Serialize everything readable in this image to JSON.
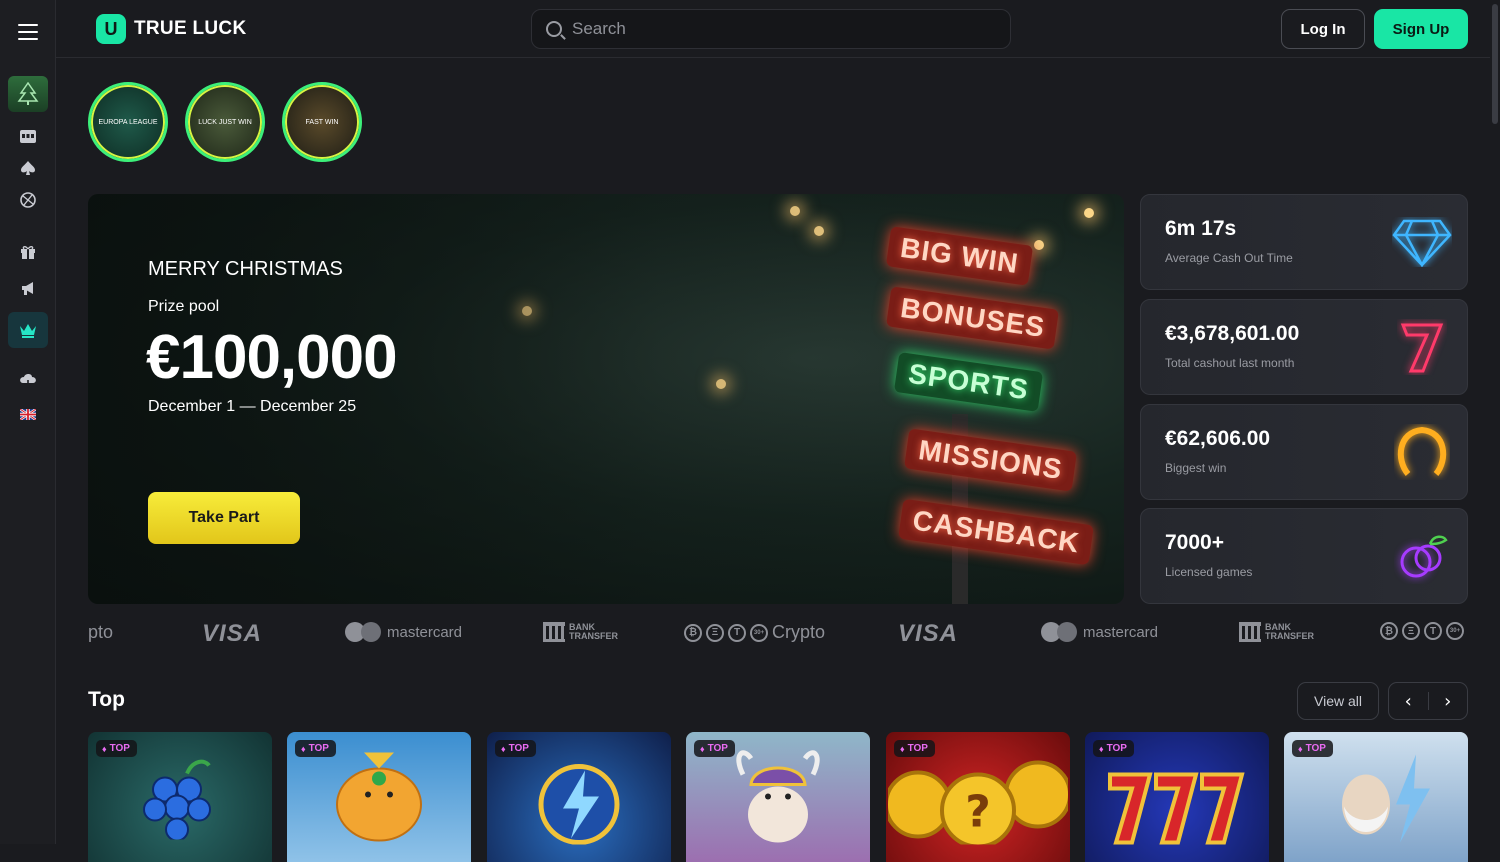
{
  "header": {
    "brand": "TRUE LUCK",
    "brand_mark": "U",
    "search_placeholder": "Search",
    "login_label": "Log In",
    "signup_label": "Sign Up"
  },
  "sidebar": {
    "items": [
      {
        "icon": "tree-icon"
      },
      {
        "icon": "slot-machine-icon"
      },
      {
        "icon": "spade-icon"
      },
      {
        "icon": "sports-ball-icon"
      },
      {
        "icon": "gift-icon"
      },
      {
        "icon": "megaphone-icon"
      },
      {
        "icon": "crown-icon"
      },
      {
        "icon": "cloud-download-icon"
      },
      {
        "icon": "uk-flag-icon"
      }
    ]
  },
  "stories": [
    {
      "caption": "EUROPA LEAGUE"
    },
    {
      "caption": "LUCK JUST WIN"
    },
    {
      "caption": "FAST WIN"
    }
  ],
  "banner": {
    "title": "MERRY CHRISTMAS",
    "subtitle": "Prize pool",
    "amount": "€100,000",
    "dates": "December 1 — December 25",
    "cta": "Take Part",
    "signs": [
      "BIG WIN",
      "BONUSES",
      "SPORTS",
      "MISSIONS",
      "CASHBACK"
    ]
  },
  "stats": [
    {
      "value": "6m 17s",
      "label": "Average Cash Out Time",
      "icon": "diamond-icon",
      "color": "#3fb6ff"
    },
    {
      "value": "€3,678,601.00",
      "label": "Total cashout last month",
      "icon": "seven-icon",
      "color": "#ff3a6a"
    },
    {
      "value": "€62,606.00",
      "label": "Biggest win",
      "icon": "horseshoe-icon",
      "color": "#ffae1f"
    },
    {
      "value": "7000+",
      "label": "Licensed games",
      "icon": "plum-icon",
      "color": "#a63bff"
    }
  ],
  "payments": {
    "crypto_partial": "pto",
    "visa": "VISA",
    "mastercard": "mastercard",
    "bank_line1": "BANK",
    "bank_line2": "TRANSFER",
    "crypto": "Crypto",
    "coins": [
      "₿",
      "Ξ",
      "T",
      "30+"
    ]
  },
  "top_section": {
    "title": "Top",
    "view_all": "View all",
    "prev": "‹",
    "next": "›",
    "tag": "TOP",
    "games": [
      {
        "icon": "grapes-icon",
        "bg": "#1c4a4a"
      },
      {
        "icon": "ganesha-icon",
        "bg": "#2f7fb8"
      },
      {
        "icon": "lightning-coin-icon",
        "bg": "#1b3f7a"
      },
      {
        "icon": "viking-icon",
        "bg": "#6b8fb0"
      },
      {
        "icon": "gold-coins-icon",
        "bg": "#a01818"
      },
      {
        "icon": "triple-seven-icon",
        "bg": "#1a2a8c"
      },
      {
        "icon": "zeus-icon",
        "bg": "#b9cde0"
      }
    ]
  }
}
